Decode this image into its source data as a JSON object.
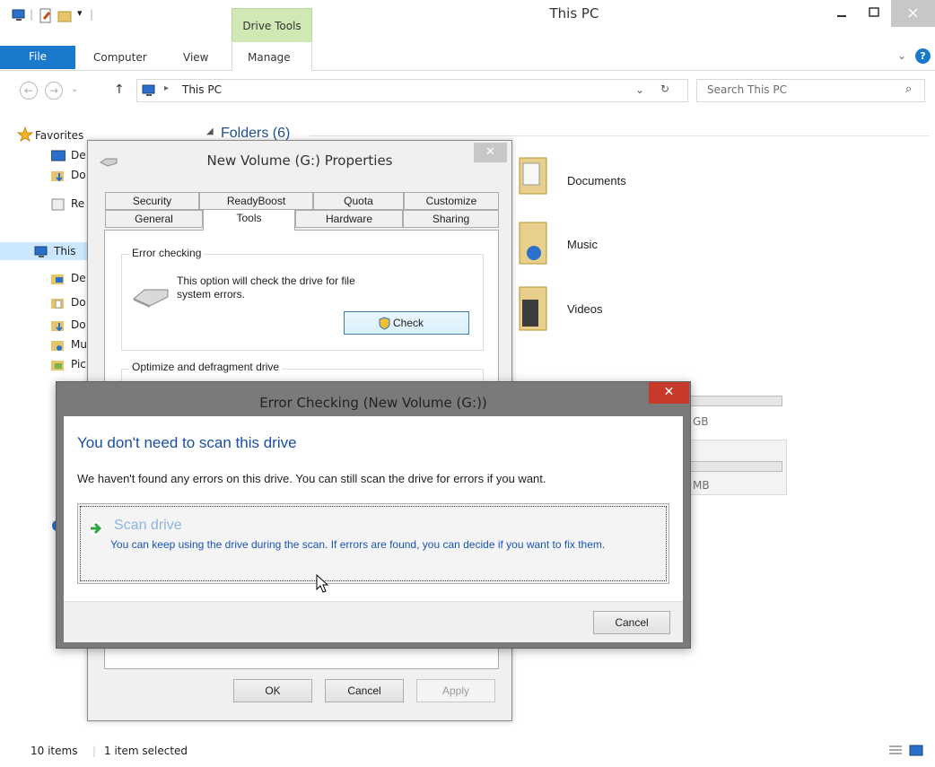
{
  "window": {
    "title": "This PC",
    "contextual_tab": "Drive Tools",
    "close_glyph": "✕",
    "min_glyph": "—",
    "max_glyph": "☐"
  },
  "ribbon": {
    "tabs": [
      "File",
      "Computer",
      "View",
      "Manage"
    ],
    "expand_glyph": "⌄",
    "help_glyph": "?"
  },
  "address": {
    "back": "←",
    "forward": "→",
    "recent": "⌄",
    "up": "↑",
    "separator": "▸",
    "path": "This PC",
    "dropdown": "⌄",
    "refresh": "↻",
    "search_placeholder": "Search This PC",
    "search_glyph": "⌕"
  },
  "nav": {
    "favorites": "Favorites",
    "fav_items": [
      "De",
      "Do",
      "Re"
    ],
    "this_pc": "This",
    "pc_items": [
      "De",
      "Do",
      "Do",
      "Mu",
      "Pic"
    ]
  },
  "content": {
    "folders_header": "Folders (6)",
    "folders": [
      "Documents",
      "Music",
      "Videos"
    ],
    "drive_fragments": [
      "GB",
      "MB"
    ]
  },
  "status": {
    "items": "10 items",
    "selected": "1 item selected"
  },
  "properties": {
    "title": "New Volume (G:) Properties",
    "close_glyph": "✕",
    "tabs_row1": [
      "Security",
      "ReadyBoost",
      "Quota",
      "Customize"
    ],
    "tabs_row2": [
      "General",
      "Tools",
      "Hardware",
      "Sharing"
    ],
    "error_group": "Error checking",
    "error_desc_line1": "This option will check the drive for file",
    "error_desc_line2": "system errors.",
    "check_button": "Check",
    "optimize_group": "Optimize and defragment drive",
    "ok": "OK",
    "cancel": "Cancel",
    "apply": "Apply"
  },
  "error_dialog": {
    "title": "Error Checking (New Volume (G:))",
    "close_glyph": "✕",
    "heading": "You don't need to scan this drive",
    "message": "We haven't found any errors on this drive. You can still scan the drive for errors if you want.",
    "scan_title": "Scan drive",
    "scan_desc": "You can keep using the drive during the scan. If errors are found, you can decide if you want to fix them.",
    "cancel": "Cancel"
  },
  "colors": {
    "file_tab": "#1979ca",
    "drive_tools": "#cfe8b4",
    "close_red": "#c7392b",
    "heading_blue": "#1a4ea1",
    "link_blue": "#1a55b6"
  }
}
